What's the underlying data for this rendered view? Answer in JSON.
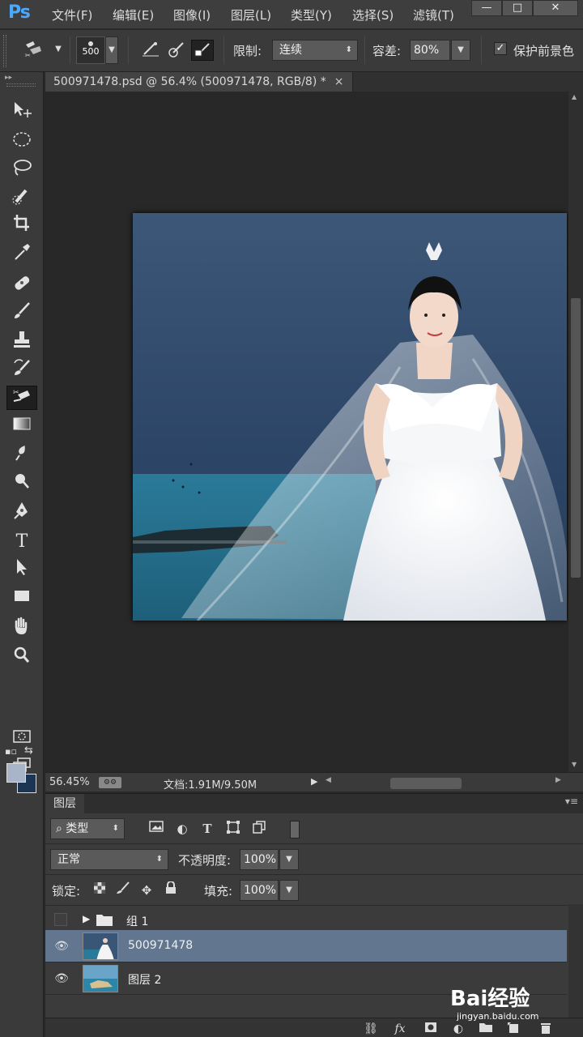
{
  "app": {
    "logo": "Ps"
  },
  "menu": [
    "文件(F)",
    "编辑(E)",
    "图像(I)",
    "图层(L)",
    "类型(Y)",
    "选择(S)",
    "滤镜(T)"
  ],
  "window_controls": {
    "minimize": "—",
    "maximize": "□",
    "close": "✕"
  },
  "options_bar": {
    "brush_size": "500",
    "limit_label": "限制:",
    "limit_value": "连续",
    "tolerance_label": "容差:",
    "tolerance_value": "80%",
    "protect_fg_label": "保护前景色",
    "protect_fg_checked": true
  },
  "document_tab": {
    "title": "500971478.psd @ 56.4% (500971478, RGB/8) *",
    "close": "×"
  },
  "tools": [
    "move-tool",
    "elliptical-marquee-tool",
    "lasso-tool",
    "quick-selection-tool",
    "crop-tool",
    "eyedropper-tool",
    "spot-healing-tool",
    "brush-tool",
    "clone-stamp-tool",
    "history-brush-tool",
    "background-eraser-tool",
    "gradient-tool",
    "blur-tool",
    "dodge-tool",
    "pen-tool",
    "type-tool",
    "path-selection-tool",
    "rectangle-tool",
    "hand-tool",
    "zoom-tool"
  ],
  "colors": {
    "foreground": "#a8b4c8",
    "background": "#1c3555",
    "accent_selected": "#62778f"
  },
  "status_bar": {
    "zoom": "56.45%",
    "doc_info": "文档:1.91M/9.50M"
  },
  "layers_panel": {
    "tab_label": "图层",
    "filter_type": "类型",
    "blend_mode": "正常",
    "opacity_label": "不透明度:",
    "opacity_value": "100%",
    "lock_label": "锁定:",
    "fill_label": "填充:",
    "fill_value": "100%",
    "layers": [
      {
        "name": "组 1",
        "type": "group",
        "visible": false,
        "selected": false
      },
      {
        "name": "500971478",
        "type": "image",
        "visible": true,
        "selected": true
      },
      {
        "name": "图层 2",
        "type": "image",
        "visible": true,
        "selected": false
      }
    ]
  },
  "watermark": {
    "logo": "Bai经验",
    "url": "jingyan.baidu.com"
  }
}
